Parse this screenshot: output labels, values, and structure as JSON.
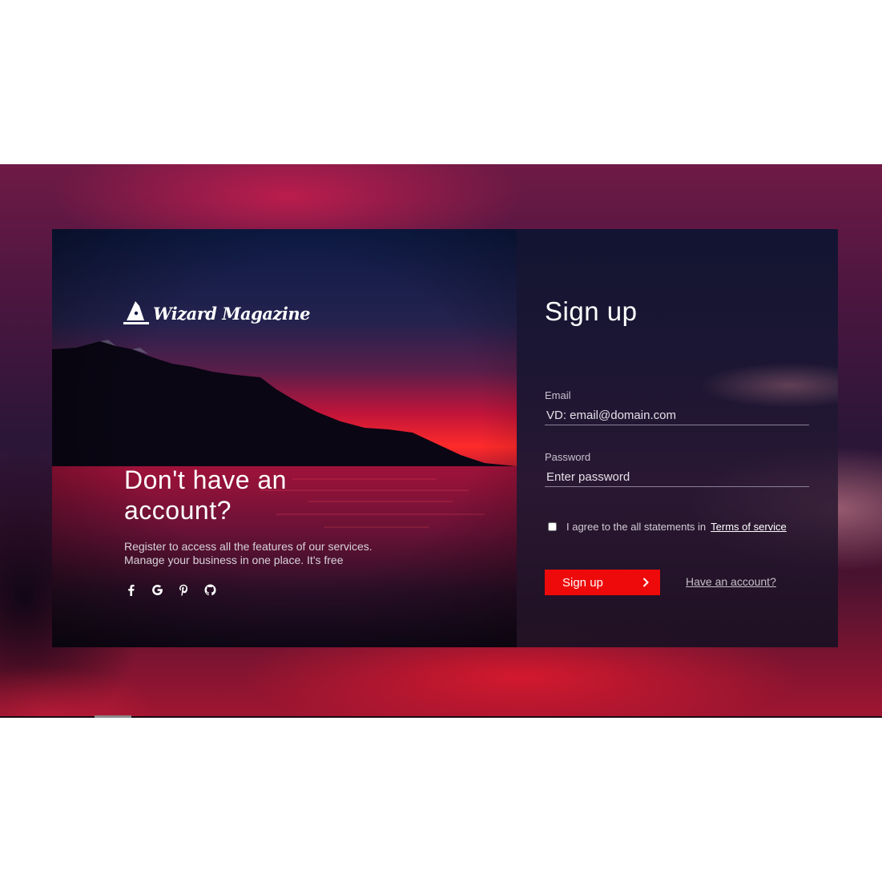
{
  "brand": {
    "name": "Wizard Magazine",
    "logo_icon": "wizard-hat-icon"
  },
  "promo": {
    "heading": "Don't have an account?",
    "subtext_line1": "Register to access all the features of our services.",
    "subtext_line2": "Manage your business in one place. It's free",
    "socials": [
      {
        "name": "facebook-icon",
        "glyph": "f"
      },
      {
        "name": "google-icon",
        "glyph": "G"
      },
      {
        "name": "pinterest-icon",
        "glyph": "P"
      },
      {
        "name": "github-icon",
        "glyph": "github"
      }
    ]
  },
  "form": {
    "title": "Sign up",
    "email": {
      "label": "Email",
      "placeholder": "VD: email@domain.com"
    },
    "password": {
      "label": "Password",
      "placeholder": "Enter password"
    },
    "agree_text": "I agree to the all statements in",
    "terms_label": "Terms of service",
    "submit_label": "Sign up",
    "have_account_label": "Have an account?"
  },
  "colors": {
    "accent": "#ee0a0a",
    "text_primary": "#ffffff",
    "text_muted": "#c9c2cc"
  }
}
